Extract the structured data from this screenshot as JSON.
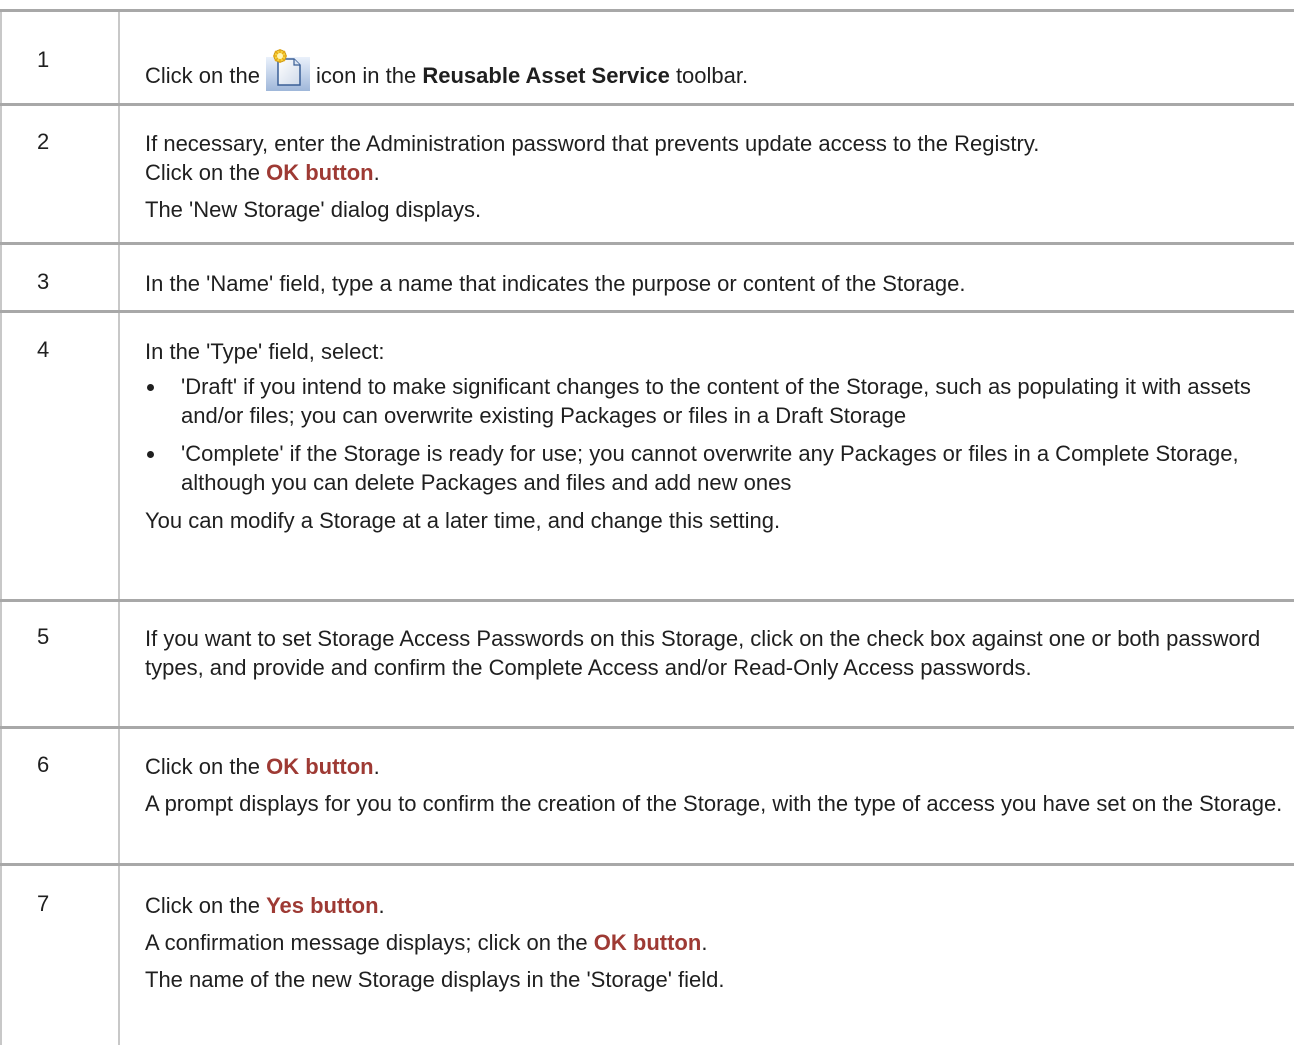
{
  "steps": [
    {
      "num": "1",
      "line1_pre": "Click on the",
      "icon": "new-storage-icon",
      "line1_mid": "icon in the",
      "line1_bold": "Reusable Asset Service",
      "line1_post": "toolbar."
    },
    {
      "num": "2",
      "p1": "If necessary, enter the Administration password that prevents update access to the Registry.",
      "p2_pre": "Click on the",
      "p2_hl": "OK button",
      "p2_post": ".",
      "p3": "The 'New Storage' dialog displays."
    },
    {
      "num": "3",
      "p1": "In the 'Name' field, type a name that indicates the purpose or content of the Storage."
    },
    {
      "num": "4",
      "p1": "In the 'Type' field, select:",
      "bullets": [
        "'Draft' if you intend to make significant changes to the content of the Storage, such as populating it with assets and/or files; you can overwrite existing Packages or files in a Draft Storage",
        "'Complete' if the Storage is ready for use; you cannot overwrite any Packages or files in a Complete Storage, although you can delete Packages and files and add new ones"
      ],
      "p2": "You can modify a Storage at a later time, and change this setting."
    },
    {
      "num": "5",
      "p1": "If you want to set Storage Access Passwords on this Storage, click on the check box against one or both password types, and provide and confirm the Complete Access and/or Read-Only Access passwords."
    },
    {
      "num": "6",
      "p1_pre": "Click on the",
      "p1_hl": "OK button",
      "p1_post": ".",
      "p2": "A prompt displays for you to confirm the creation of the Storage, with the type of access you have set on the Storage."
    },
    {
      "num": "7",
      "p1_pre": "Click on the",
      "p1_hl": "Yes button",
      "p1_post": ".",
      "p2_pre": "A confirmation message displays; click on the",
      "p2_hl": "OK button",
      "p2_post": ".",
      "p3": "The name of the new Storage displays in the 'Storage' field."
    }
  ]
}
